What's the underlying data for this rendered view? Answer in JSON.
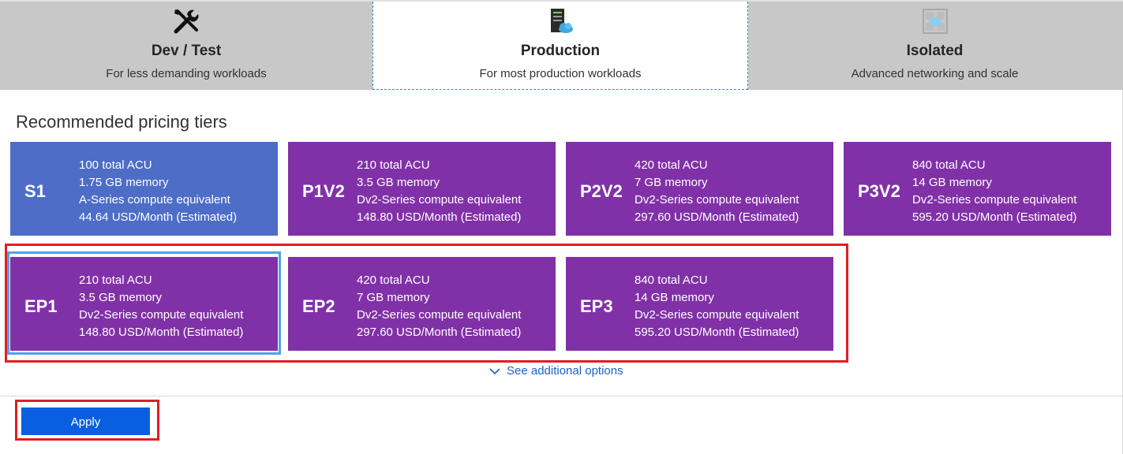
{
  "tabs": [
    {
      "title": "Dev / Test",
      "subtitle": "For less demanding workloads",
      "icon": "tools-icon"
    },
    {
      "title": "Production",
      "subtitle": "For most production workloads",
      "icon": "server-cloud-icon"
    },
    {
      "title": "Isolated",
      "subtitle": "Advanced networking and scale",
      "icon": "isolated-network-icon"
    }
  ],
  "heading": "Recommended pricing tiers",
  "tiers": [
    {
      "code": "S1",
      "acu": "100 total ACU",
      "memory": "1.75 GB memory",
      "series": "A-Series compute equivalent",
      "price": "44.64 USD/Month (Estimated)",
      "color": "#4d6dc7"
    },
    {
      "code": "P1V2",
      "acu": "210 total ACU",
      "memory": "3.5 GB memory",
      "series": "Dv2-Series compute equivalent",
      "price": "148.80 USD/Month (Estimated)",
      "color": "#8131a7"
    },
    {
      "code": "P2V2",
      "acu": "420 total ACU",
      "memory": "7 GB memory",
      "series": "Dv2-Series compute equivalent",
      "price": "297.60 USD/Month (Estimated)",
      "color": "#8131a7"
    },
    {
      "code": "P3V2",
      "acu": "840 total ACU",
      "memory": "14 GB memory",
      "series": "Dv2-Series compute equivalent",
      "price": "595.20 USD/Month (Estimated)",
      "color": "#8131a7"
    },
    {
      "code": "EP1",
      "acu": "210 total ACU",
      "memory": "3.5 GB memory",
      "series": "Dv2-Series compute equivalent",
      "price": "148.80 USD/Month (Estimated)",
      "color": "#8131a7"
    },
    {
      "code": "EP2",
      "acu": "420 total ACU",
      "memory": "7 GB memory",
      "series": "Dv2-Series compute equivalent",
      "price": "297.60 USD/Month (Estimated)",
      "color": "#8131a7"
    },
    {
      "code": "EP3",
      "acu": "840 total ACU",
      "memory": "14 GB memory",
      "series": "Dv2-Series compute equivalent",
      "price": "595.20 USD/Month (Estimated)",
      "color": "#8131a7"
    }
  ],
  "more_options": "See additional options",
  "apply_label": "Apply",
  "colors": {
    "accent": "#0a5fe0",
    "highlight_red": "#e01e24",
    "selected_blue": "#4fa3e6"
  }
}
